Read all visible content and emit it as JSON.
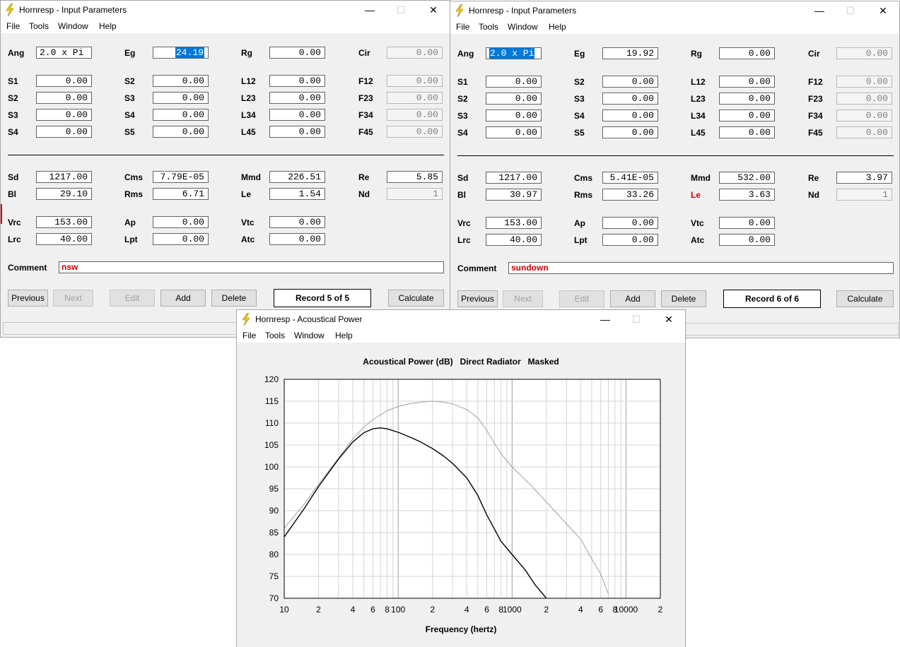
{
  "win1": {
    "title": "Hornresp - Input Parameters",
    "menu": [
      "File",
      "Tools",
      "Window",
      "Help"
    ],
    "params": {
      "ang": {
        "label": "Ang",
        "value": "2.0 x Pi"
      },
      "eg": {
        "label": "Eg",
        "value": "24.19"
      },
      "rg": {
        "label": "Rg",
        "value": "0.00"
      },
      "cir": {
        "label": "Cir",
        "value": "0.00"
      },
      "s1": {
        "label": "S1",
        "value": "0.00"
      },
      "s2": {
        "label": "S2",
        "value": "0.00"
      },
      "s3": {
        "label": "S3",
        "value": "0.00"
      },
      "s4": {
        "label": "S4",
        "value": "0.00"
      },
      "s2b": {
        "label": "S2",
        "value": "0.00"
      },
      "s3b": {
        "label": "S3",
        "value": "0.00"
      },
      "s4b": {
        "label": "S4",
        "value": "0.00"
      },
      "s5": {
        "label": "S5",
        "value": "0.00"
      },
      "l12": {
        "label": "L12",
        "value": "0.00"
      },
      "l23": {
        "label": "L23",
        "value": "0.00"
      },
      "l34": {
        "label": "L34",
        "value": "0.00"
      },
      "l45": {
        "label": "L45",
        "value": "0.00"
      },
      "f12": {
        "label": "F12",
        "value": "0.00"
      },
      "f23": {
        "label": "F23",
        "value": "0.00"
      },
      "f34": {
        "label": "F34",
        "value": "0.00"
      },
      "f45": {
        "label": "F45",
        "value": "0.00"
      },
      "sd": {
        "label": "Sd",
        "value": "1217.00"
      },
      "bl": {
        "label": "Bl",
        "value": "29.10"
      },
      "cms": {
        "label": "Cms",
        "value": "7.79E-05"
      },
      "rms": {
        "label": "Rms",
        "value": "6.71"
      },
      "mmd": {
        "label": "Mmd",
        "value": "226.51"
      },
      "le": {
        "label": "Le",
        "value": "1.54"
      },
      "re": {
        "label": "Re",
        "value": "5.85"
      },
      "nd": {
        "label": "Nd",
        "value": "1"
      },
      "vrc": {
        "label": "Vrc",
        "value": "153.00"
      },
      "lrc": {
        "label": "Lrc",
        "value": "40.00"
      },
      "ap": {
        "label": "Ap",
        "value": "0.00"
      },
      "lpt": {
        "label": "Lpt",
        "value": "0.00"
      },
      "vtc": {
        "label": "Vtc",
        "value": "0.00"
      },
      "atc": {
        "label": "Atc",
        "value": "0.00"
      }
    },
    "comment_label": "Comment",
    "comment": "nsw",
    "buttons": {
      "previous": "Previous",
      "next": "Next",
      "edit": "Edit",
      "add": "Add",
      "delete": "Delete",
      "calculate": "Calculate"
    },
    "record": "Record 5 of 5"
  },
  "win2": {
    "title": "Hornresp - Input Parameters",
    "menu": [
      "File",
      "Tools",
      "Window",
      "Help"
    ],
    "params": {
      "ang": {
        "label": "Ang",
        "value": "2.0 x Pi"
      },
      "eg": {
        "label": "Eg",
        "value": "19.92"
      },
      "rg": {
        "label": "Rg",
        "value": "0.00"
      },
      "cir": {
        "label": "Cir",
        "value": "0.00"
      },
      "s1": {
        "label": "S1",
        "value": "0.00"
      },
      "s2": {
        "label": "S2",
        "value": "0.00"
      },
      "s3": {
        "label": "S3",
        "value": "0.00"
      },
      "s4": {
        "label": "S4",
        "value": "0.00"
      },
      "s2b": {
        "label": "S2",
        "value": "0.00"
      },
      "s3b": {
        "label": "S3",
        "value": "0.00"
      },
      "s4b": {
        "label": "S4",
        "value": "0.00"
      },
      "s5": {
        "label": "S5",
        "value": "0.00"
      },
      "l12": {
        "label": "L12",
        "value": "0.00"
      },
      "l23": {
        "label": "L23",
        "value": "0.00"
      },
      "l34": {
        "label": "L34",
        "value": "0.00"
      },
      "l45": {
        "label": "L45",
        "value": "0.00"
      },
      "f12": {
        "label": "F12",
        "value": "0.00"
      },
      "f23": {
        "label": "F23",
        "value": "0.00"
      },
      "f34": {
        "label": "F34",
        "value": "0.00"
      },
      "f45": {
        "label": "F45",
        "value": "0.00"
      },
      "sd": {
        "label": "Sd",
        "value": "1217.00"
      },
      "bl": {
        "label": "Bl",
        "value": "30.97"
      },
      "cms": {
        "label": "Cms",
        "value": "5.41E-05"
      },
      "rms": {
        "label": "Rms",
        "value": "33.26"
      },
      "mmd": {
        "label": "Mmd",
        "value": "532.00"
      },
      "le": {
        "label": "Le",
        "value": "3.63"
      },
      "re": {
        "label": "Re",
        "value": "3.97"
      },
      "nd": {
        "label": "Nd",
        "value": "1"
      },
      "vrc": {
        "label": "Vrc",
        "value": "153.00"
      },
      "lrc": {
        "label": "Lrc",
        "value": "40.00"
      },
      "ap": {
        "label": "Ap",
        "value": "0.00"
      },
      "lpt": {
        "label": "Lpt",
        "value": "0.00"
      },
      "vtc": {
        "label": "Vtc",
        "value": "0.00"
      },
      "atc": {
        "label": "Atc",
        "value": "0.00"
      }
    },
    "comment_label": "Comment",
    "comment": "sundown",
    "buttons": {
      "previous": "Previous",
      "next": "Next",
      "edit": "Edit",
      "add": "Add",
      "delete": "Delete",
      "calculate": "Calculate"
    },
    "record": "Record 6 of 6"
  },
  "win3": {
    "title": "Hornresp - Acoustical Power",
    "menu": [
      "File",
      "Tools",
      "Window",
      "Help"
    ]
  },
  "colors": {
    "accent": "#0078d7",
    "comment_text": "#d00000",
    "window_bg": "#f0f0f0"
  },
  "chart_data": {
    "type": "line",
    "title": "Acoustical Power (dB)   Direct Radiator   Masked",
    "xlabel": "Frequency (hertz)",
    "ylabel": "",
    "xscale": "log",
    "xlim": [
      10,
      20000
    ],
    "ylim": [
      70,
      120
    ],
    "yticks": [
      70,
      75,
      80,
      85,
      90,
      95,
      100,
      105,
      110,
      115,
      120
    ],
    "xtick_labels": [
      {
        "v": 10,
        "t": "10"
      },
      {
        "v": 20,
        "t": "2"
      },
      {
        "v": 40,
        "t": "4"
      },
      {
        "v": 60,
        "t": "6"
      },
      {
        "v": 80,
        "t": "8"
      },
      {
        "v": 100,
        "t": "100"
      },
      {
        "v": 200,
        "t": "2"
      },
      {
        "v": 400,
        "t": "4"
      },
      {
        "v": 600,
        "t": "6"
      },
      {
        "v": 800,
        "t": "8"
      },
      {
        "v": 1000,
        "t": "1000"
      },
      {
        "v": 2000,
        "t": "2"
      },
      {
        "v": 4000,
        "t": "4"
      },
      {
        "v": 6000,
        "t": "6"
      },
      {
        "v": 8000,
        "t": "8"
      },
      {
        "v": 10000,
        "t": "10000"
      },
      {
        "v": 20000,
        "t": "2"
      }
    ],
    "grid": true,
    "series": [
      {
        "color": "#000000",
        "x": [
          10,
          15,
          20,
          30,
          40,
          50,
          60,
          70,
          80,
          100,
          130,
          160,
          200,
          250,
          300,
          400,
          500,
          600,
          800,
          1000,
          1300,
          1600,
          2000
        ],
        "y": [
          84,
          90.5,
          95.5,
          101.8,
          105.7,
          107.8,
          108.7,
          108.9,
          108.7,
          107.9,
          106.7,
          105.6,
          104.2,
          102.5,
          100.8,
          97.5,
          93.5,
          89,
          83,
          80,
          76.5,
          73,
          70
        ]
      },
      {
        "color": "#a0a0a0",
        "x": [
          10,
          15,
          20,
          30,
          40,
          50,
          60,
          80,
          100,
          130,
          160,
          200,
          250,
          300,
          400,
          500,
          600,
          700,
          800,
          1000,
          1200,
          1500,
          2000,
          3000,
          4000,
          5000,
          6000,
          7000
        ],
        "y": [
          86,
          91.5,
          96,
          102,
          106.4,
          109.1,
          110.8,
          112.8,
          113.8,
          114.5,
          114.8,
          115,
          114.8,
          114.4,
          113.1,
          111.2,
          108.3,
          105.4,
          103,
          100,
          98,
          95.5,
          92,
          87,
          83.5,
          79,
          75.5,
          71
        ]
      }
    ]
  }
}
